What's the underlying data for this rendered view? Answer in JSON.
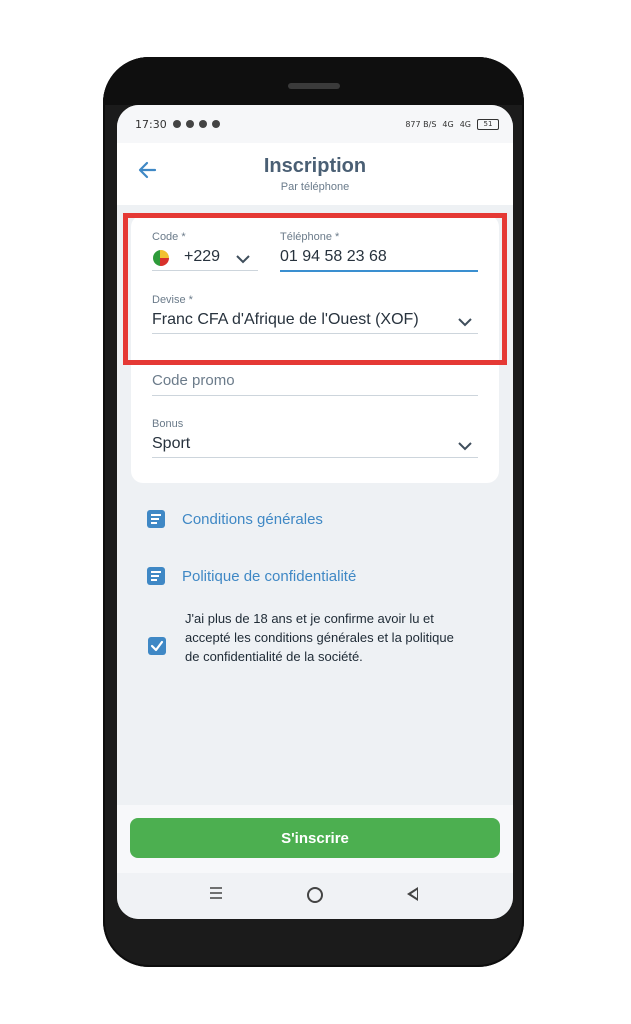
{
  "status": {
    "time": "17:30",
    "data_rate": "877 B/S",
    "net1": "4G",
    "net2": "4G",
    "battery": "51"
  },
  "header": {
    "title": "Inscription",
    "subtitle": "Par téléphone"
  },
  "form": {
    "code": {
      "label": "Code *",
      "value": "+229"
    },
    "phone": {
      "label": "Téléphone *",
      "value": "01 94 58 23 68"
    },
    "currency": {
      "label": "Devise *",
      "value": "Franc CFA d'Afrique de l'Ouest (XOF)"
    },
    "promo": {
      "placeholder": "Code promo"
    },
    "bonus": {
      "label": "Bonus",
      "value": "Sport"
    }
  },
  "links": {
    "terms": "Conditions générales",
    "privacy": "Politique de confidentialité"
  },
  "consent": {
    "checked": true,
    "text": "J'ai plus de 18 ans et je confirme avoir lu et accepté les conditions générales et la politique de confidentialité de la société."
  },
  "submit": {
    "label": "S'inscrire"
  },
  "colors": {
    "accent": "#3f88c5",
    "primary_button": "#4caf50",
    "highlight": "#e53935",
    "title": "#4a5f74"
  },
  "icons": [
    "back-arrow-icon",
    "chevron-down-icon",
    "document-icon",
    "checkbox-icon",
    "flag-icon",
    "menu-icon",
    "home-icon",
    "back-icon"
  ]
}
